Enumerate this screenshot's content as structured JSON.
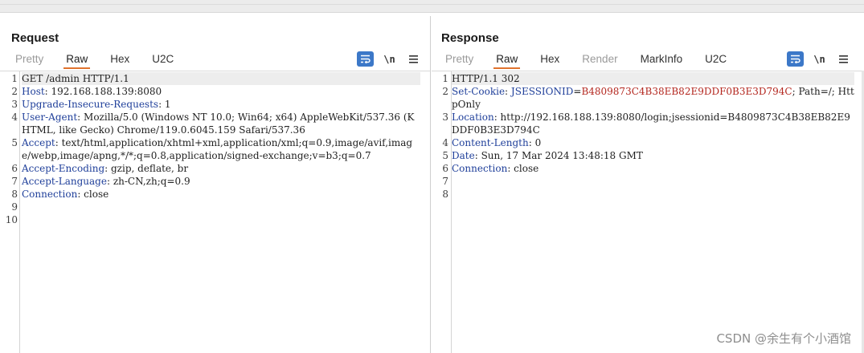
{
  "request": {
    "title": "Request",
    "tabs": [
      "Pretty",
      "Raw",
      "Hex",
      "U2C"
    ],
    "active_tab": "Raw",
    "lines": [
      {
        "num": "1",
        "name": "",
        "sep": "",
        "value": "GET /admin HTTP/1.1"
      },
      {
        "num": "2",
        "name": "Host",
        "sep": ": ",
        "value": "192.168.188.139:8080"
      },
      {
        "num": "3",
        "name": "Upgrade-Insecure-Requests",
        "sep": ": ",
        "value": "1"
      },
      {
        "num": "4",
        "name": "User-Agent",
        "sep": ": ",
        "value": "Mozilla/5.0 (Windows NT 10.0; Win64; x64) AppleWebKit/537.36 (KHTML, like Gecko) Chrome/119.0.6045.159 Safari/537.36"
      },
      {
        "num": "5",
        "name": "Accept",
        "sep": ": ",
        "value": "text/html,application/xhtml+xml,application/xml;q=0.9,image/avif,image/webp,image/apng,*/*;q=0.8,application/signed-exchange;v=b3;q=0.7"
      },
      {
        "num": "6",
        "name": "Accept-Encoding",
        "sep": ": ",
        "value": "gzip, deflate, br"
      },
      {
        "num": "7",
        "name": "Accept-Language",
        "sep": ": ",
        "value": "zh-CN,zh;q=0.9"
      },
      {
        "num": "8",
        "name": "Connection",
        "sep": ": ",
        "value": "close"
      },
      {
        "num": "9",
        "name": "",
        "sep": "",
        "value": ""
      },
      {
        "num": "10",
        "name": "",
        "sep": "",
        "value": ""
      }
    ]
  },
  "response": {
    "title": "Response",
    "tabs": [
      "Pretty",
      "Raw",
      "Hex",
      "Render",
      "MarkInfo",
      "U2C"
    ],
    "active_tab": "Raw",
    "dim_tabs": [
      "Pretty",
      "Render"
    ],
    "lines": [
      {
        "num": "1",
        "name": "",
        "sep": "",
        "value": "HTTP/1.1 302"
      },
      {
        "num": "2",
        "name": "Set-Cookie",
        "sep": ": ",
        "cookie_name": "JSESSIONID",
        "cookie_value": "B4809873C4B38EB82E9DDF0B3E3D794C",
        "value": "; Path=/; HttpOnly"
      },
      {
        "num": "3",
        "name": "Location",
        "sep": ": ",
        "value": "http://192.168.188.139:8080/login;jsessionid=B4809873C4B38EB82E9DDF0B3E3D794C"
      },
      {
        "num": "4",
        "name": "Content-Length",
        "sep": ": ",
        "value": "0"
      },
      {
        "num": "5",
        "name": "Date",
        "sep": ": ",
        "value": "Sun, 17 Mar 2024 13:48:18 GMT"
      },
      {
        "num": "6",
        "name": "Connection",
        "sep": ": ",
        "value": "close"
      },
      {
        "num": "7",
        "name": "",
        "sep": "",
        "value": ""
      },
      {
        "num": "8",
        "name": "",
        "sep": "",
        "value": ""
      }
    ]
  },
  "toolbar": {
    "newline_label": "\\n"
  },
  "icons": [
    "layout-split-icon",
    "layout-rows-icon",
    "layout-single-icon",
    "wrap-icon",
    "menu-icon"
  ],
  "colors": {
    "accent": "#3c78c8",
    "tab_underline": "#e0722e",
    "header_name": "#1f3f9a",
    "cookie_value": "#b3261e"
  },
  "watermark": "CSDN @余生有个小酒馆"
}
